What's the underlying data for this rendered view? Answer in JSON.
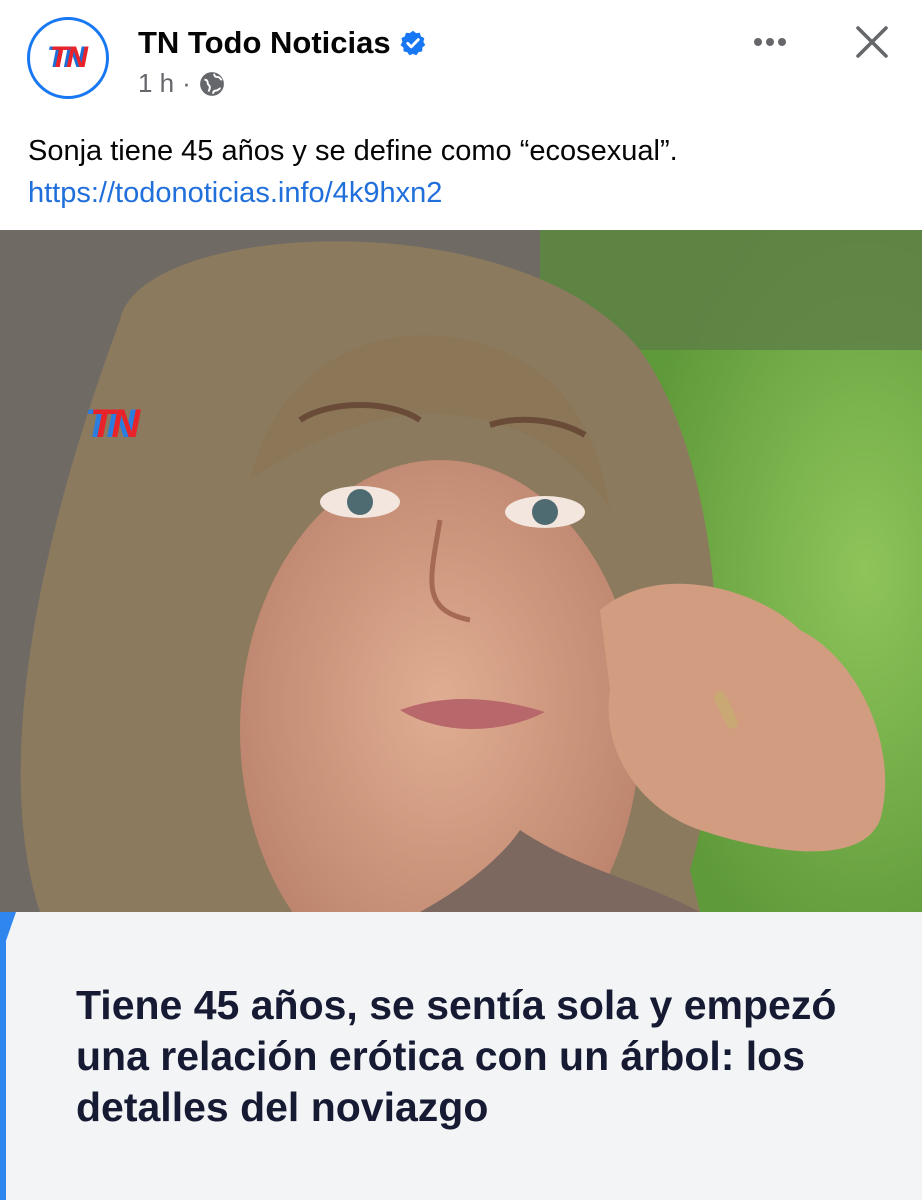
{
  "post": {
    "avatar_text": "TN",
    "page_name": "TN Todo Noticias",
    "time": "1 h",
    "separator": "·",
    "text": "Sonja tiene 45 años y se define como “ecosexual”.",
    "link": "https://todonoticias.info/4k9hxn2"
  },
  "icons": {
    "verified": "verified-badge-icon",
    "privacy": "globe-icon",
    "more": "more-options-icon",
    "close": "close-icon"
  },
  "image": {
    "watermark": "TN"
  },
  "card": {
    "headline": "Tiene 45 años, se sentía sola y empezó una relación erótica con un árbol: los detalles del noviazgo"
  },
  "colors": {
    "accent": "#1877f2",
    "link": "#216fdb",
    "brand_red": "#e8232a",
    "brand_blue": "#2f86ef"
  }
}
